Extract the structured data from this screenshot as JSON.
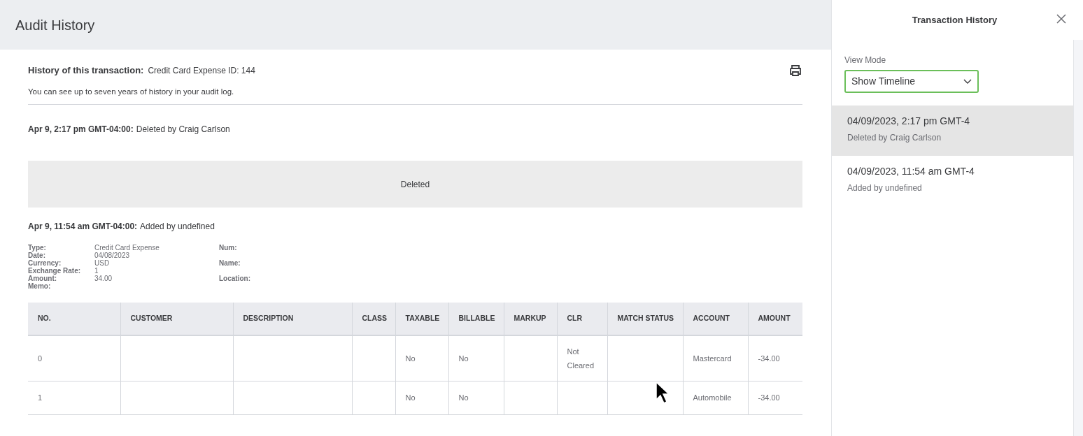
{
  "page": {
    "title": "Audit History"
  },
  "summary": {
    "label": "History of this transaction:",
    "value": "Credit Card Expense ID: 144",
    "note": "You can see up to seven years of history in your audit log."
  },
  "events": [
    {
      "kind": "deleted",
      "timestamp": "Apr 9, 2:17 pm GMT-04:00:",
      "action": "Deleted by Craig Carlson",
      "banner": "Deleted"
    },
    {
      "kind": "added",
      "timestamp": "Apr 9, 11:54 am GMT-04:00:",
      "action": "Added by undefined",
      "details": [
        {
          "label": "Type:",
          "value": "Credit Card Expense",
          "extra_label": "Num:"
        },
        {
          "label": "Date:",
          "value": "04/08/2023"
        },
        {
          "label": "Currency:",
          "value": "USD",
          "extra_label": "Name:"
        },
        {
          "label": "Exchange Rate:",
          "value": "1"
        },
        {
          "label": "Amount:",
          "value": "34.00",
          "extra_label": "Location:"
        },
        {
          "label": "Memo:"
        }
      ],
      "table": {
        "columns": [
          "NO.",
          "CUSTOMER",
          "DESCRIPTION",
          "CLASS",
          "TAXABLE",
          "BILLABLE",
          "MARKUP",
          "CLR",
          "MATCH STATUS",
          "ACCOUNT",
          "AMOUNT"
        ],
        "rows": [
          [
            "0",
            "",
            "",
            "",
            "No",
            "No",
            "",
            "Not Cleared",
            "",
            "Mastercard",
            "-34.00"
          ],
          [
            "1",
            "",
            "",
            "",
            "No",
            "No",
            "",
            "",
            "",
            "Automobile",
            "-34.00"
          ]
        ]
      }
    }
  ],
  "panel": {
    "title": "Transaction History",
    "view_mode": {
      "label": "View Mode",
      "value": "Show Timeline"
    },
    "items": [
      {
        "title": "04/09/2023, 2:17 pm GMT-4",
        "subtitle": "Deleted by Craig Carlson",
        "selected": true
      },
      {
        "title": "04/09/2023, 11:54 am GMT-4",
        "subtitle": "Added by undefined",
        "selected": false
      }
    ]
  }
}
